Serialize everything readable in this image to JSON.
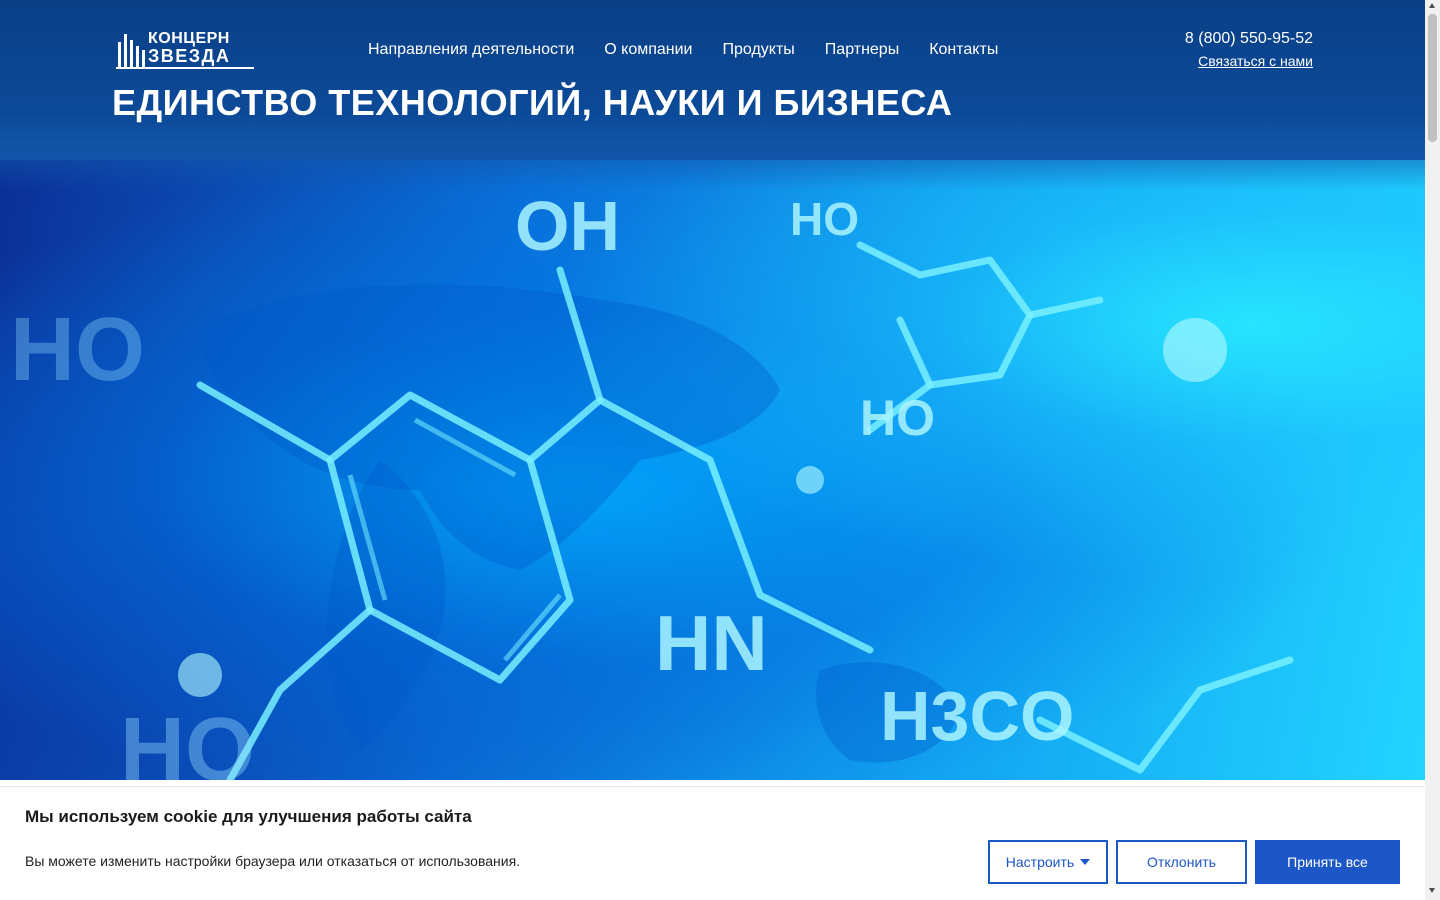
{
  "header": {
    "logo": {
      "line1": "КОНЦЕРН",
      "line2": "ЗВЕЗДА"
    },
    "nav": [
      "Направления деятельности",
      "О компании",
      "Продукты",
      "Партнеры",
      "Контакты"
    ],
    "phone": "8 (800) 550-95-52",
    "contact_link": "Связаться с нами"
  },
  "hero": {
    "title": "ЕДИНСТВО ТЕХНОЛОГИЙ, НАУКИ И БИЗНЕСА",
    "image_labels": [
      "OH",
      "HO",
      "HO",
      "HO",
      "HN",
      "H3CO",
      "HO"
    ]
  },
  "cookie_banner": {
    "title": "Мы используем cookie для улучшения работы сайта",
    "text": "Вы можете изменить настройки браузера или отказаться от использования.",
    "configure_label": "Настроить",
    "decline_label": "Отклонить",
    "accept_label": "Принять все"
  },
  "colors": {
    "header_bg": "#0c4a98",
    "accent": "#1c56c7",
    "hero_cyan": "#22d4ff"
  }
}
